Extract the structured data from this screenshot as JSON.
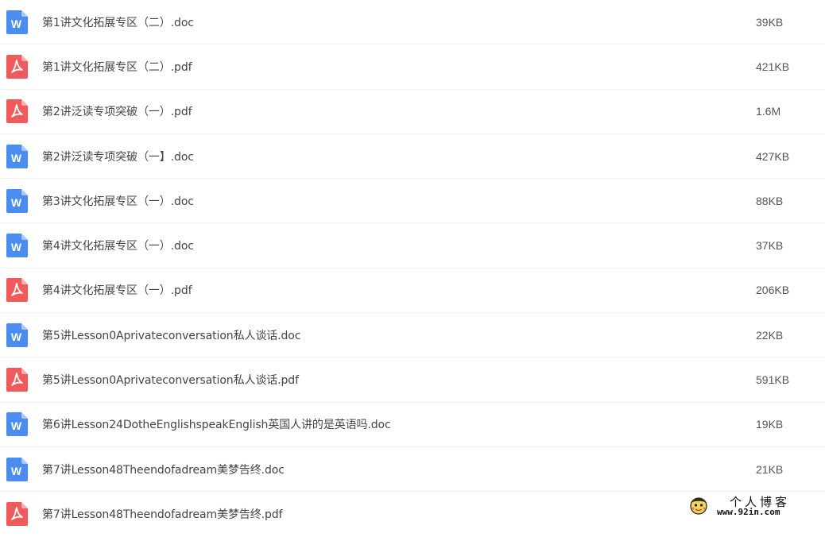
{
  "files": [
    {
      "type": "doc",
      "icon": "word-doc-icon",
      "name": "第1讲文化拓展专区（二）.doc",
      "size": "39KB"
    },
    {
      "type": "pdf",
      "icon": "pdf-icon",
      "name": "第1讲文化拓展专区（二）.pdf",
      "size": "421KB"
    },
    {
      "type": "pdf",
      "icon": "pdf-icon",
      "name": "第2讲泛读专项突破（一）.pdf",
      "size": "1.6M"
    },
    {
      "type": "doc",
      "icon": "word-doc-icon",
      "name": "第2讲泛读专项突破（一】.doc",
      "size": "427KB"
    },
    {
      "type": "doc",
      "icon": "word-doc-icon",
      "name": "第3讲文化拓展专区（一）.doc",
      "size": "88KB"
    },
    {
      "type": "doc",
      "icon": "word-doc-icon",
      "name": "第4讲文化拓展专区（一）.doc",
      "size": "37KB"
    },
    {
      "type": "pdf",
      "icon": "pdf-icon",
      "name": "第4讲文化拓展专区（一）.pdf",
      "size": "206KB"
    },
    {
      "type": "doc",
      "icon": "word-doc-icon",
      "name": "第5讲Lesson0Aprivateconversation私人谈话.doc",
      "size": "22KB"
    },
    {
      "type": "pdf",
      "icon": "pdf-icon",
      "name": "第5讲Lesson0Aprivateconversation私人谈话.pdf",
      "size": "591KB"
    },
    {
      "type": "doc",
      "icon": "word-doc-icon",
      "name": "第6讲Lesson24DotheEnglishspeakEnglish英国人讲的是英语吗.doc",
      "size": "19KB"
    },
    {
      "type": "doc",
      "icon": "word-doc-icon",
      "name": "第7讲Lesson48Theendofadream美梦告终.doc",
      "size": "21KB"
    },
    {
      "type": "pdf",
      "icon": "pdf-icon",
      "name": "第7讲Lesson48Theendofadream美梦告终.pdf",
      "size": ""
    }
  ],
  "colors": {
    "doc_icon": "#4a8cf0",
    "pdf_icon": "#f15a5a",
    "text": "#444444",
    "divider": "#f0f0f0"
  },
  "watermark": {
    "title": "个人博客",
    "url": "www.92in.com",
    "icon": "blog-avatar-icon"
  }
}
